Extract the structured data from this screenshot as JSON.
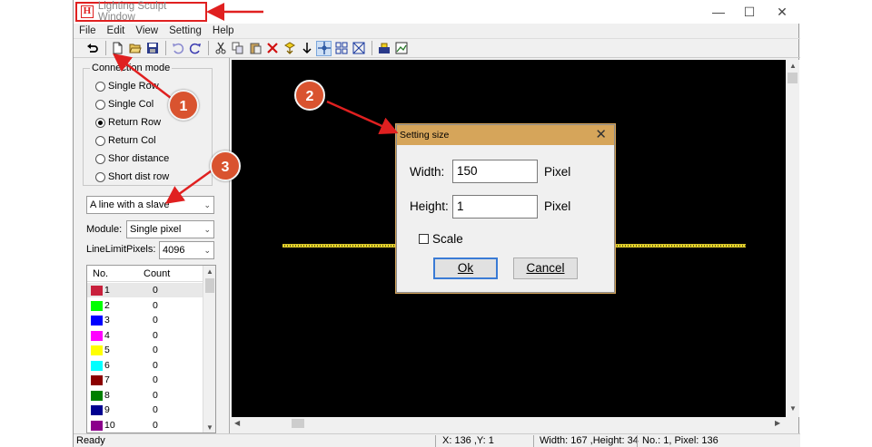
{
  "window": {
    "title": "Lighting Sculpt Window",
    "logo_glyph": "H",
    "controls": {
      "minimize": "—",
      "maximize": "☐",
      "close": "✕"
    }
  },
  "menu": [
    "File",
    "Edit",
    "View",
    "Setting",
    "Help"
  ],
  "toolbar": {
    "icons": [
      "undo-arrow-icon",
      "new-file-icon",
      "open-folder-icon",
      "save-icon",
      "undo-icon",
      "redo-icon",
      "cut-icon",
      "copy-icon",
      "paste-icon",
      "delete-icon",
      "move-icon",
      "down-arrow-icon",
      "crosshair-icon",
      "grid-icon",
      "select-box-icon",
      "export-icon",
      "image-icon"
    ]
  },
  "connection_mode": {
    "legend": "Connection mode",
    "options": [
      "Single Row",
      "Single Col",
      "Return Row",
      "Return Col",
      "Shor distance",
      "Short dist row"
    ],
    "selected": "Return Row"
  },
  "line_mode": {
    "value": "A line with a slave"
  },
  "module": {
    "label": "Module:",
    "value": "Single pixel"
  },
  "line_limit": {
    "label": "LineLimitPixels:",
    "value": "4096"
  },
  "port_list": {
    "headers": {
      "no": "No.",
      "count": "Count"
    },
    "rows": [
      {
        "no": "1",
        "count": "0",
        "color": "#c8203c"
      },
      {
        "no": "2",
        "count": "0",
        "color": "#00ff00"
      },
      {
        "no": "3",
        "count": "0",
        "color": "#0000ff"
      },
      {
        "no": "4",
        "count": "0",
        "color": "#ff00ff"
      },
      {
        "no": "5",
        "count": "0",
        "color": "#ffff00"
      },
      {
        "no": "6",
        "count": "0",
        "color": "#00ffff"
      },
      {
        "no": "7",
        "count": "0",
        "color": "#8b0000"
      },
      {
        "no": "8",
        "count": "0",
        "color": "#008000"
      },
      {
        "no": "9",
        "count": "0",
        "color": "#000090"
      },
      {
        "no": "10",
        "count": "0",
        "color": "#8b008b"
      }
    ]
  },
  "dialog": {
    "title": "Setting size",
    "width_label": "Width:",
    "width_value": "150",
    "height_label": "Height:",
    "height_value": "1",
    "unit": "Pixel",
    "scale_label": "Scale",
    "ok_label": "Ok",
    "cancel_label": "Cancel"
  },
  "status": {
    "ready": "Ready",
    "coords": "X: 136 ,Y: 1",
    "size": "Width: 167 ,Height: 34",
    "pixel_info": "No.: 1, Pixel: 136"
  },
  "callouts": [
    "1",
    "2",
    "3"
  ],
  "colors": {
    "annotation_red": "#e02020",
    "callout_fill": "#d9532f",
    "dialog_title": "#d6a55a"
  }
}
